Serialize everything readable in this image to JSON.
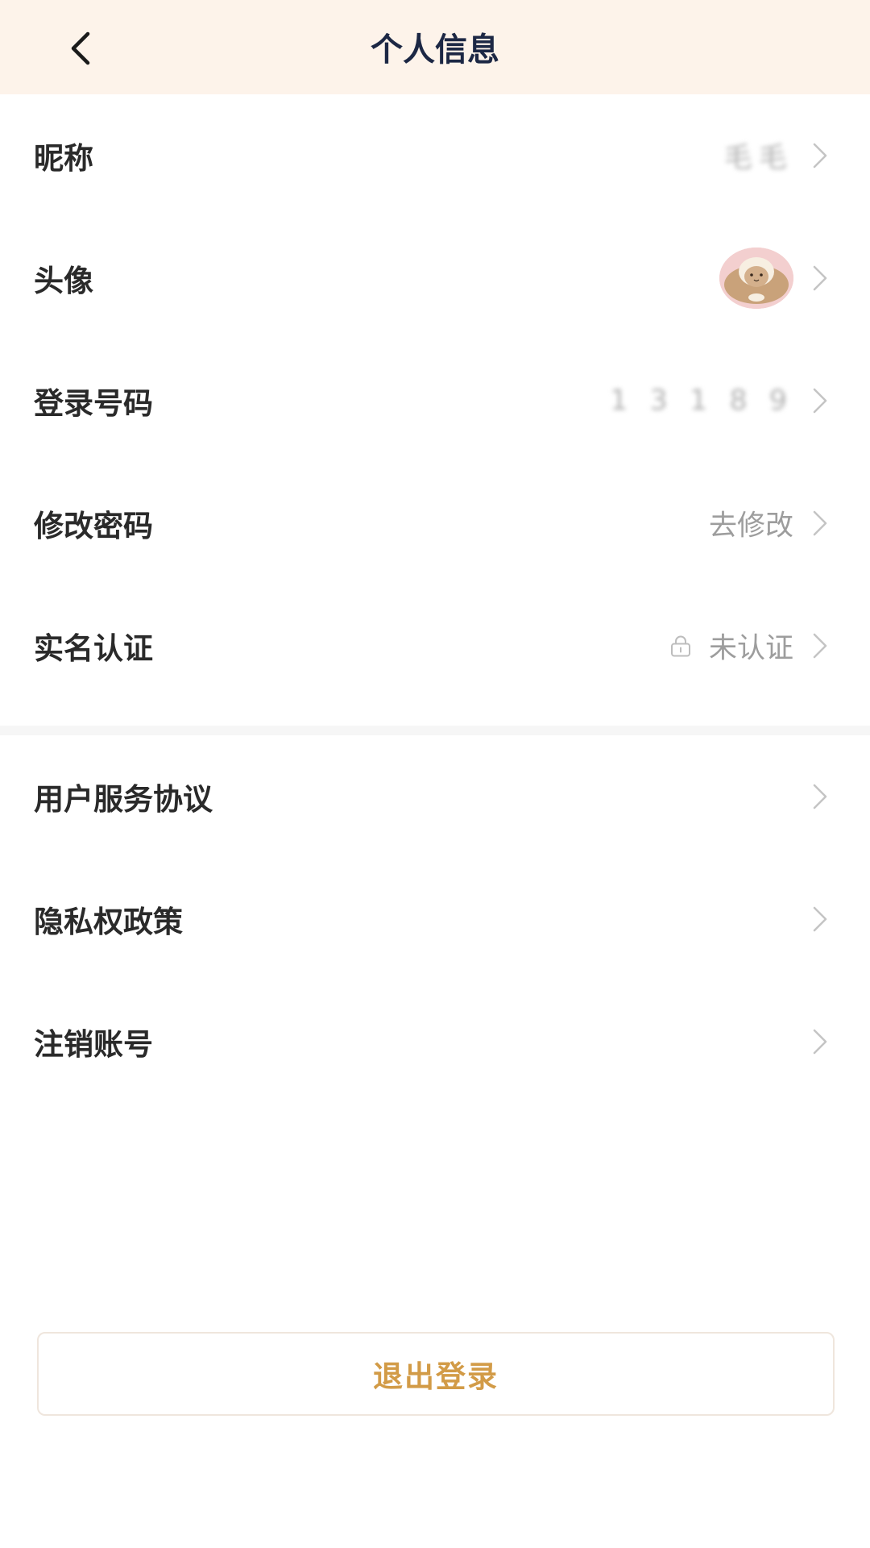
{
  "header": {
    "title": "个人信息",
    "back_icon": "chevron-left-icon"
  },
  "profile_rows": [
    {
      "label": "昵称",
      "value": "毛毛"
    },
    {
      "label": "头像",
      "value": ""
    },
    {
      "label": "登录号码",
      "value": "1 3 1 8 9"
    },
    {
      "label": "修改密码",
      "value": "去修改"
    },
    {
      "label": "实名认证",
      "value": "未认证"
    }
  ],
  "info_rows": [
    {
      "label": "用户服务协议"
    },
    {
      "label": "隐私权政策"
    },
    {
      "label": "注销账号"
    }
  ],
  "logout": {
    "label": "退出登录"
  },
  "colors": {
    "header_bg": "#fdf3ea",
    "title": "#1c2744",
    "logout_text": "#d29b47",
    "secondary_text": "#9d9d9d"
  }
}
